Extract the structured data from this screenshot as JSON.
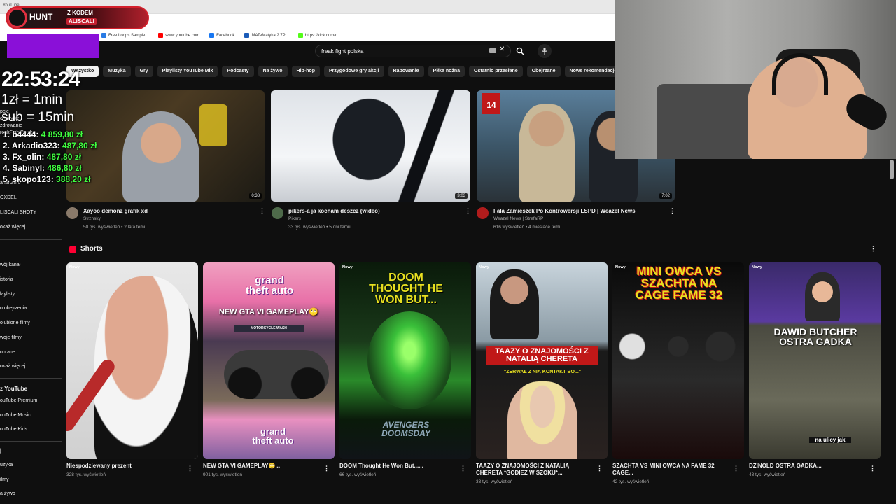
{
  "browser": {
    "tab_title": "YouTube",
    "bookmarks": [
      {
        "label": "Free Loops Sample...",
        "color": "#2a7be4"
      },
      {
        "label": "www.youtube.com",
        "color": "#ff0000"
      },
      {
        "label": "Facebook",
        "color": "#1877f2"
      },
      {
        "label": "MATeMatyka 2.7P...",
        "color": "#1a5bb8"
      },
      {
        "label": "https://kick.com/d...",
        "color": "#53fc18"
      }
    ]
  },
  "search": {
    "query": "freak fight polska"
  },
  "chips": [
    {
      "label": "Wszystko",
      "active": true
    },
    {
      "label": "Muzyka"
    },
    {
      "label": "Gry"
    },
    {
      "label": "Playlisty YouTube Mix"
    },
    {
      "label": "Podcasty"
    },
    {
      "label": "Na żywo"
    },
    {
      "label": "Hip-hop"
    },
    {
      "label": "Przygodowe gry akcji"
    },
    {
      "label": "Rapowanie"
    },
    {
      "label": "Piłka nożna"
    },
    {
      "label": "Ostatnio przesłane"
    },
    {
      "label": "Obejrzane"
    },
    {
      "label": "Nowe rekomendacje"
    }
  ],
  "sidebar": {
    "items_top": [
      "pcje",
      "onacyjkę",
      "zdrowanie",
      "reakFightPolska",
      "anał Zero",
      "OXDEL",
      "LISCALI SHOTY",
      "okaż więcej"
    ],
    "you_items": [
      "wój kanał",
      "istoria",
      "laylisty",
      "o obejrzenia",
      "olubione filmy",
      "woje filmy",
      "obrane",
      "okaż więcej"
    ],
    "more_header": "z YouTube",
    "more_items": [
      "ouTube Premium",
      "ouTube Music",
      "ouTube Kids"
    ],
    "explore_items": [
      "j",
      "uzyka",
      "ilmy",
      "a żywo"
    ]
  },
  "videos": [
    {
      "title": "Xayoo demonz grafik xd",
      "channel": "Strznsky",
      "meta": "50 tys. wyświetleń • 2 lata temu",
      "duration": "0:38"
    },
    {
      "title": "pikers-a ja kocham deszcz (wideo)",
      "channel": "Pikers",
      "meta": "33 tys. wyświetleń • 5 dni temu",
      "duration": "3:03"
    },
    {
      "title": "Fala Zamieszek Po Kontrowersji LSPD | Weazel News",
      "channel": "Weazel News | StrefaRP",
      "meta": "616 wyświetleń • 4 miesiące temu",
      "duration": "7:02"
    }
  ],
  "shorts": {
    "section_title": "Shorts",
    "badge": "Nowy",
    "items": [
      {
        "title": "Niespodziewany prezent",
        "meta": "328 tys. wyświetleń"
      },
      {
        "title": "NEW GTA VI GAMEPLAY🙄...",
        "meta": "901 tys. wyświetleń",
        "overlay": "NEW GTA VI GAMEPLAY🙄",
        "sub": "MOTORCYCLE WASH",
        "logo": "grand theft auto"
      },
      {
        "title": "DOOM Thought He Won But......",
        "meta": "66 tys. wyświetleń",
        "overlay": "DOOM THOUGHT HE WON BUT...",
        "logo": "AVENGERS DOOMSDAY"
      },
      {
        "title": "TAAZY O ZNAJOMOŚCI Z NATALIĄ CHERETA *GODIEZ W SZOKU*...",
        "meta": "33 tys. wyświetleń",
        "overlay": "TAAZY O ZNAJOMOŚCI Z NATALIĄ CHERETA",
        "sub": "\"ZERWAŁ Z NIĄ KONTAKT BO...\""
      },
      {
        "title": "SZACHTA VS MINI OWCA NA FAME 32 CAGE...",
        "meta": "42 tys. wyświetleń",
        "overlay": "MINI OWCA VS SZACHTA NA CAGE FAME 32"
      },
      {
        "title": "DZINOLD OSTRA GADKA...",
        "meta": "43 tys. wyświetleń",
        "overlay": "DAWID BUTCHER OSTRA GADKA",
        "sub": "na ulicy jak"
      }
    ]
  },
  "overlay": {
    "promo_name": "HUNT",
    "promo_line1": "Z KODEM",
    "promo_line2": "ALISCALI",
    "clock": "22:53:24",
    "rate1": "1zł = 1min",
    "rate2": "sub = 15min",
    "leaderboard": [
      {
        "label": "1. b4444:",
        "amount": "4 859,80 zł"
      },
      {
        "label": "2. Arkadio323:",
        "amount": "487,80 zł"
      },
      {
        "label": "3. Fx_olin:",
        "amount": "487,80 zł"
      },
      {
        "label": "4. Sabinyl:",
        "amount": "486,80 zł"
      },
      {
        "label": "5. skopo123:",
        "amount": "388,20 zł"
      }
    ]
  },
  "colors": {
    "bg": "#0f0f0f",
    "accent": "#ff0033",
    "money": "#40ff40"
  }
}
